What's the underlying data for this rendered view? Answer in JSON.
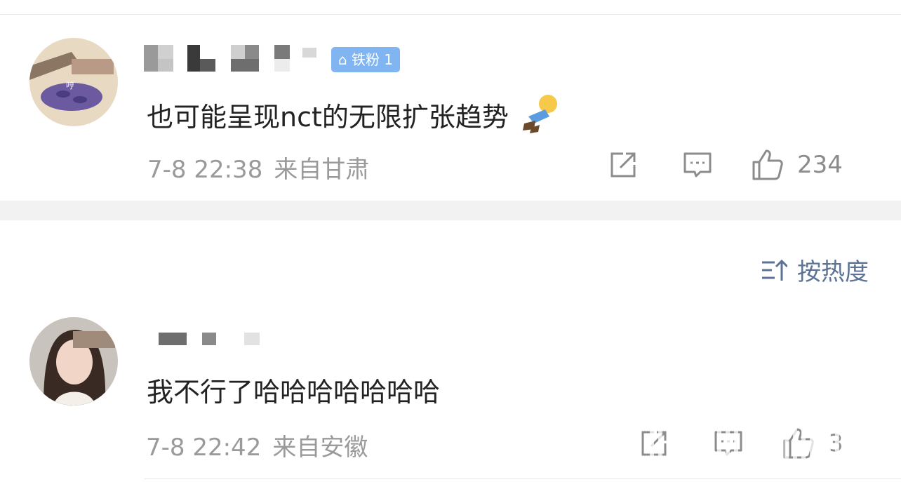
{
  "comments": [
    {
      "content": "也可能呈现nct的无限扩张趋势",
      "emoji_icon": "lying-figure-emoji-icon",
      "time": "7-8 22:38",
      "location": "来自甘肃",
      "badge_text": "⌂ 铁粉 1",
      "likes": "234"
    },
    {
      "content": "我不行了哈哈哈哈哈哈哈",
      "time": "7-8 22:42",
      "location": "来自安徽",
      "likes": "3"
    }
  ],
  "sort": {
    "label": "按热度",
    "icon": "sort-icon"
  },
  "icons": {
    "share": "share-icon",
    "comment": "comment-icon",
    "like": "thumb-up-icon"
  },
  "colors": {
    "accent": "#5d7396",
    "meta": "#9a9a9a",
    "divider": "#f2f2f2"
  }
}
